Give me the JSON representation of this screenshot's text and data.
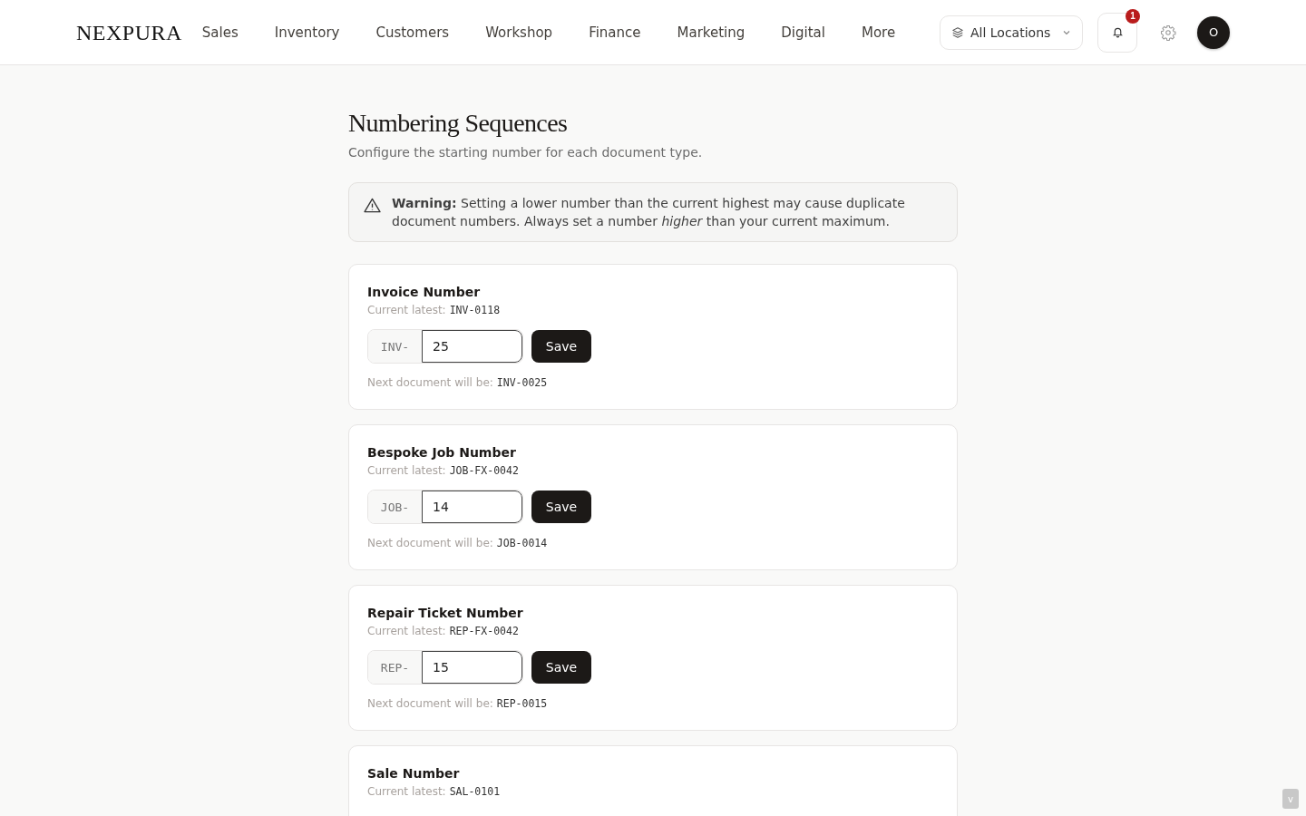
{
  "brand": "NEXPURA",
  "nav": [
    {
      "label": "Sales"
    },
    {
      "label": "Inventory"
    },
    {
      "label": "Customers"
    },
    {
      "label": "Workshop"
    },
    {
      "label": "Finance"
    },
    {
      "label": "Marketing"
    },
    {
      "label": "Digital"
    },
    {
      "label": "More"
    }
  ],
  "location_select": {
    "value": "All Locations"
  },
  "notifications": {
    "count": "1"
  },
  "avatar": {
    "initial": "O"
  },
  "page": {
    "title": "Numbering Sequences",
    "subtitle": "Configure the starting number for each document type."
  },
  "warning": {
    "text": "**Warning:** Setting a lower number than the current highest may cause duplicate document numbers. Always set a number *higher* than your current maximum."
  },
  "sequences": [
    {
      "title": "Invoice Number",
      "latest_label": "Current latest:",
      "latest": "INV-0118",
      "prefix": "INV-",
      "value": "25",
      "button": "Save",
      "next_label": "Next document will be:",
      "next": "INV-0025"
    },
    {
      "title": "Bespoke Job Number",
      "latest_label": "Current latest:",
      "latest": "JOB-FX-0042",
      "prefix": "JOB-",
      "value": "14",
      "button": "Save",
      "next_label": "Next document will be:",
      "next": "JOB-0014"
    },
    {
      "title": "Repair Ticket Number",
      "latest_label": "Current latest:",
      "latest": "REP-FX-0042",
      "prefix": "REP-",
      "value": "15",
      "button": "Save",
      "next_label": "Next document will be:",
      "next": "REP-0015"
    },
    {
      "title": "Sale Number",
      "latest_label": "Current latest:",
      "latest": "SAL-0101"
    }
  ],
  "corner_tab": {
    "label": "v"
  }
}
